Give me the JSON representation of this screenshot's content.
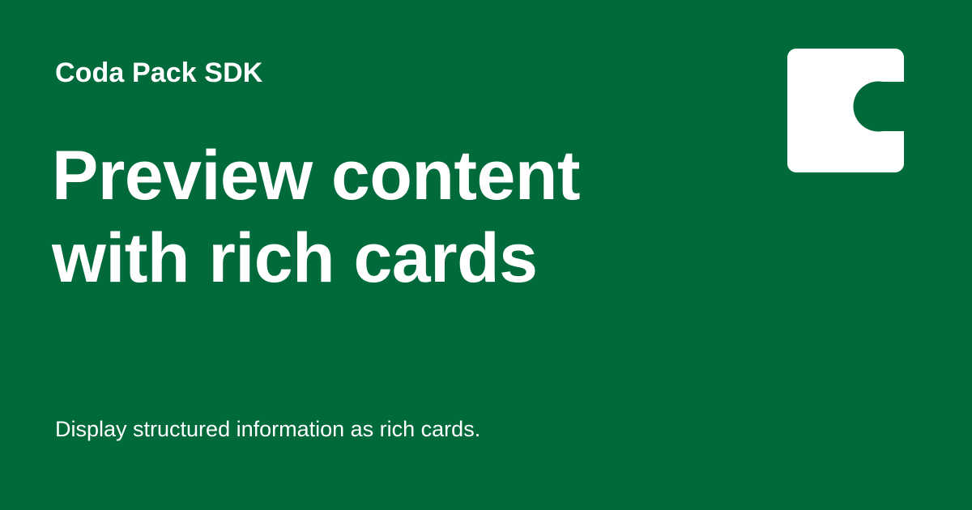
{
  "colors": {
    "background": "#006a3b",
    "text": "#ffffff",
    "logo_fill": "#ffffff",
    "logo_cutout": "#006a3b"
  },
  "header": {
    "eyebrow": "Coda Pack SDK"
  },
  "hero": {
    "title": "Preview content with rich cards",
    "subtitle": "Display structured information as rich cards."
  },
  "logo": {
    "icon": "coda-logo-icon"
  }
}
